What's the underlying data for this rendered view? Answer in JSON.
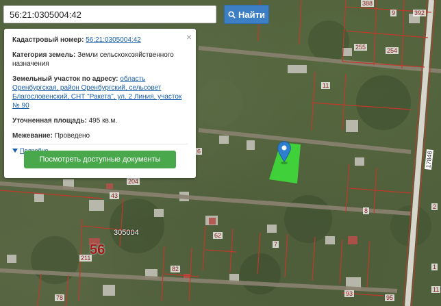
{
  "search": {
    "value": "56:21:0305004:42",
    "button_label": "Найти"
  },
  "popup": {
    "cadastral_label": "Кадастровый номер:",
    "cadastral_value": "56:21:0305004:42",
    "category_label": "Категория земель:",
    "category_value": "Земли сельскохозяйственного назначения",
    "address_label": "Земельный участок по адресу:",
    "address_value": "область Оренбургская, район Оренбургский, сельсовет Благословенский, СНТ \"Ракета\", ул. 2 Линия, участок № 90",
    "area_label": "Уточненная площадь:",
    "area_value": "495 кв.м.",
    "survey_label": "Межевание:",
    "survey_value": "Проведено",
    "more_label": "Подробно",
    "docs_button": "Посмотреть доступные документы",
    "close": "×"
  },
  "map": {
    "quarter_label": "305004",
    "block_number": "56",
    "parcel_numbers": [
      "388",
      "9",
      "392",
      "255",
      "254",
      "11",
      "204",
      "62",
      "7",
      "8",
      "211",
      "82",
      "78",
      "93",
      "95",
      "11",
      "1",
      "6",
      "2",
      "43"
    ],
    "road_label": "17846",
    "selected_color": "#3fd63a",
    "boundary_color": "#c0392b"
  }
}
